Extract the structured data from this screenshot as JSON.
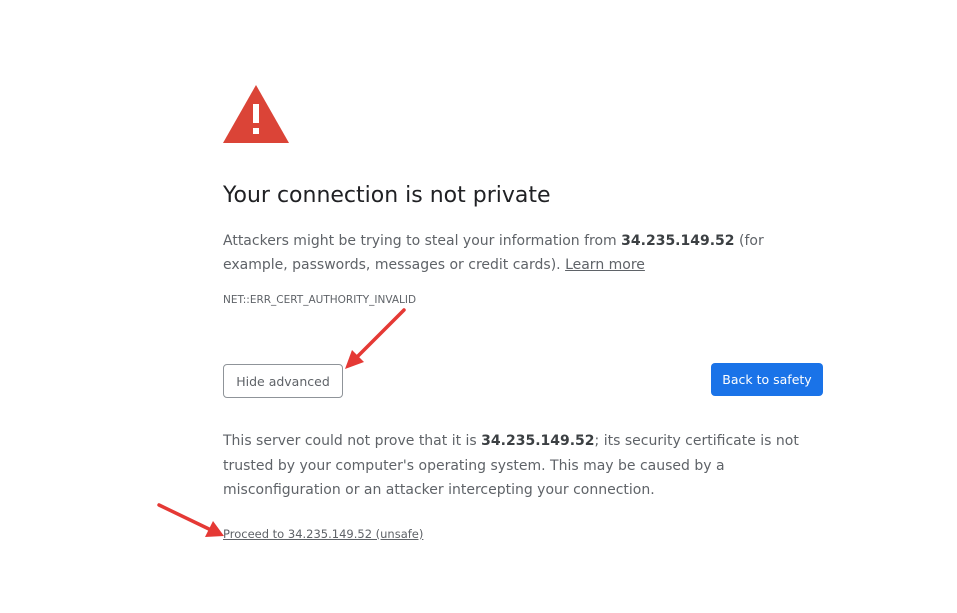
{
  "heading": "Your connection is not private",
  "description": {
    "prefix": "Attackers might be trying to steal your information from ",
    "host": "34.235.149.52",
    "suffix": " (for example, passwords, messages or credit cards). ",
    "learn_more": "Learn more"
  },
  "error_code": "NET::ERR_CERT_AUTHORITY_INVALID",
  "buttons": {
    "hide_advanced": "Hide advanced",
    "back_to_safety": "Back to safety"
  },
  "explanation": {
    "prefix": "This server could not prove that it is ",
    "host": "34.235.149.52",
    "suffix": "; its security certificate is not trusted by your computer's operating system. This may be caused by a misconfiguration or an attacker intercepting your connection."
  },
  "proceed_link": "Proceed to 34.235.149.52 (unsafe)",
  "colors": {
    "warning": "#db4437",
    "primary": "#1a73e8",
    "annotation": "#e53935"
  },
  "icons": {
    "warning": "warning-triangle-icon"
  }
}
